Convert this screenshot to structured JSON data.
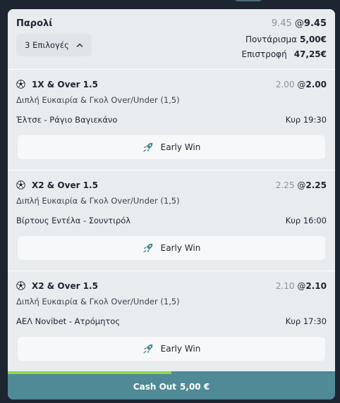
{
  "header": {
    "title": "Παρολί",
    "odds_old": "9.45",
    "odds_at": "@",
    "odds_new": "9.45",
    "selections_label": "3 Επιλογές",
    "stake_label": "Ποντάρισμα",
    "stake_value": "5,00€",
    "return_label": "Επιστροφή",
    "return_value": "47,25€"
  },
  "legs": [
    {
      "selection": "1X & Over 1.5",
      "odds_old": "2.00",
      "odds_new": "2.00",
      "market": "Διπλή Ευκαιρία & Γκολ Over/Under (1,5)",
      "event": "Έλτσε - Ράγιο Βαγιεκάνο",
      "time": "Κυρ 19:30",
      "early_win": "Early Win"
    },
    {
      "selection": "X2 & Over 1.5",
      "odds_old": "2.25",
      "odds_new": "2.25",
      "market": "Διπλή Ευκαιρία & Γκολ Over/Under (1,5)",
      "event": "Βίρτους Εντέλα - Σουντιρόλ",
      "time": "Κυρ 16:00",
      "early_win": "Early Win"
    },
    {
      "selection": "X2 & Over 1.5",
      "odds_old": "2.10",
      "odds_new": "2.10",
      "market": "Διπλή Ευκαιρία & Γκολ Over/Under (1,5)",
      "event": "ΑΕΛ Novibet - Ατρόμητος",
      "time": "Κυρ 17:30",
      "early_win": "Early Win"
    }
  ],
  "icons": {
    "sport": "soccer-ball-icon",
    "early_win": "rocket-icon",
    "selections_toggle": "chevron-up-icon"
  },
  "cashout": {
    "label": "Cash Out",
    "amount": "5,00 €",
    "progress": 0.5
  },
  "colors": {
    "panel_bg": "#e8ecef",
    "cashout_bg": "#4f8a96",
    "progress_fill": "#8bd84a",
    "muted_odds": "#8a939c",
    "early_win_icon": "#4f8a96"
  }
}
